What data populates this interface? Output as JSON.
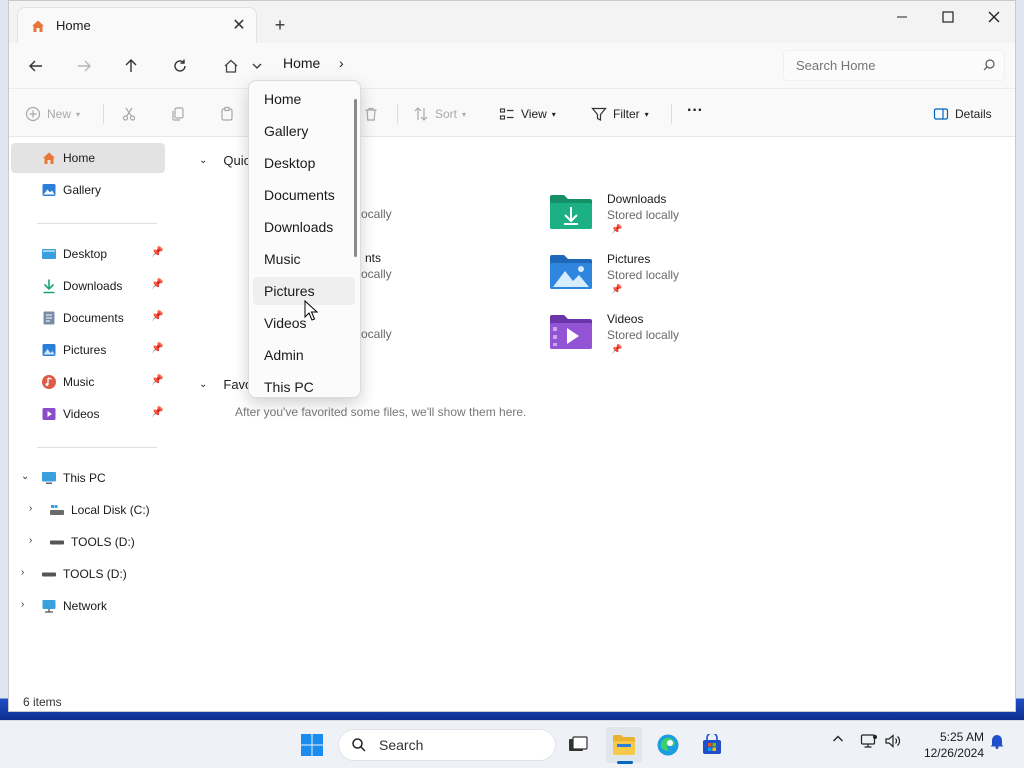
{
  "window": {
    "tab_title": "Home",
    "tab_close": "✕",
    "new_tab": "+"
  },
  "addressbar": {
    "breadcrumb_root": "Home",
    "breadcrumb_sep": "›",
    "search_placeholder": "Search Home"
  },
  "commandbar": {
    "new_label": "New",
    "sort_label": "Sort",
    "view_label": "View",
    "filter_label": "Filter",
    "more_label": "···",
    "details_label": "Details"
  },
  "sidebar": {
    "top_items": [
      {
        "label": "Home"
      },
      {
        "label": "Gallery"
      }
    ],
    "pinned_items": [
      {
        "label": "Desktop"
      },
      {
        "label": "Downloads"
      },
      {
        "label": "Documents"
      },
      {
        "label": "Pictures"
      },
      {
        "label": "Music"
      },
      {
        "label": "Videos"
      }
    ],
    "tree_items": [
      {
        "label": "This PC"
      },
      {
        "label": "Local Disk (C:)"
      },
      {
        "label": "TOOLS (D:)"
      },
      {
        "label": "TOOLS (D:)"
      },
      {
        "label": "Network"
      }
    ]
  },
  "main": {
    "quick_access_head": "Quic",
    "favorites_head": "Favo",
    "favorites_empty": "After you've favorited some files, we'll show them here.",
    "partial_texts": [
      "ocally",
      "nts",
      "ocally",
      "ocally"
    ],
    "quick_access_items": [
      {
        "name": "Downloads",
        "sub": "Stored locally"
      },
      {
        "name": "Pictures",
        "sub": "Stored locally"
      },
      {
        "name": "Videos",
        "sub": "Stored locally"
      }
    ]
  },
  "dropdown": {
    "items": [
      "Home",
      "Gallery",
      "Desktop",
      "Documents",
      "Downloads",
      "Music",
      "Pictures",
      "Videos",
      "Admin",
      "This PC"
    ],
    "hovered": "Pictures"
  },
  "status": {
    "item_count": "6 items"
  },
  "taskbar": {
    "search_label": "Search",
    "time": "5:25 AM",
    "date": "12/26/2024"
  },
  "colors": {
    "accent": "#0067c0",
    "home_icon": "#e8763a",
    "downloads_green": "#1aa37a",
    "pictures_blue": "#2b7fd8",
    "videos_purple": "#8a4cc7"
  }
}
